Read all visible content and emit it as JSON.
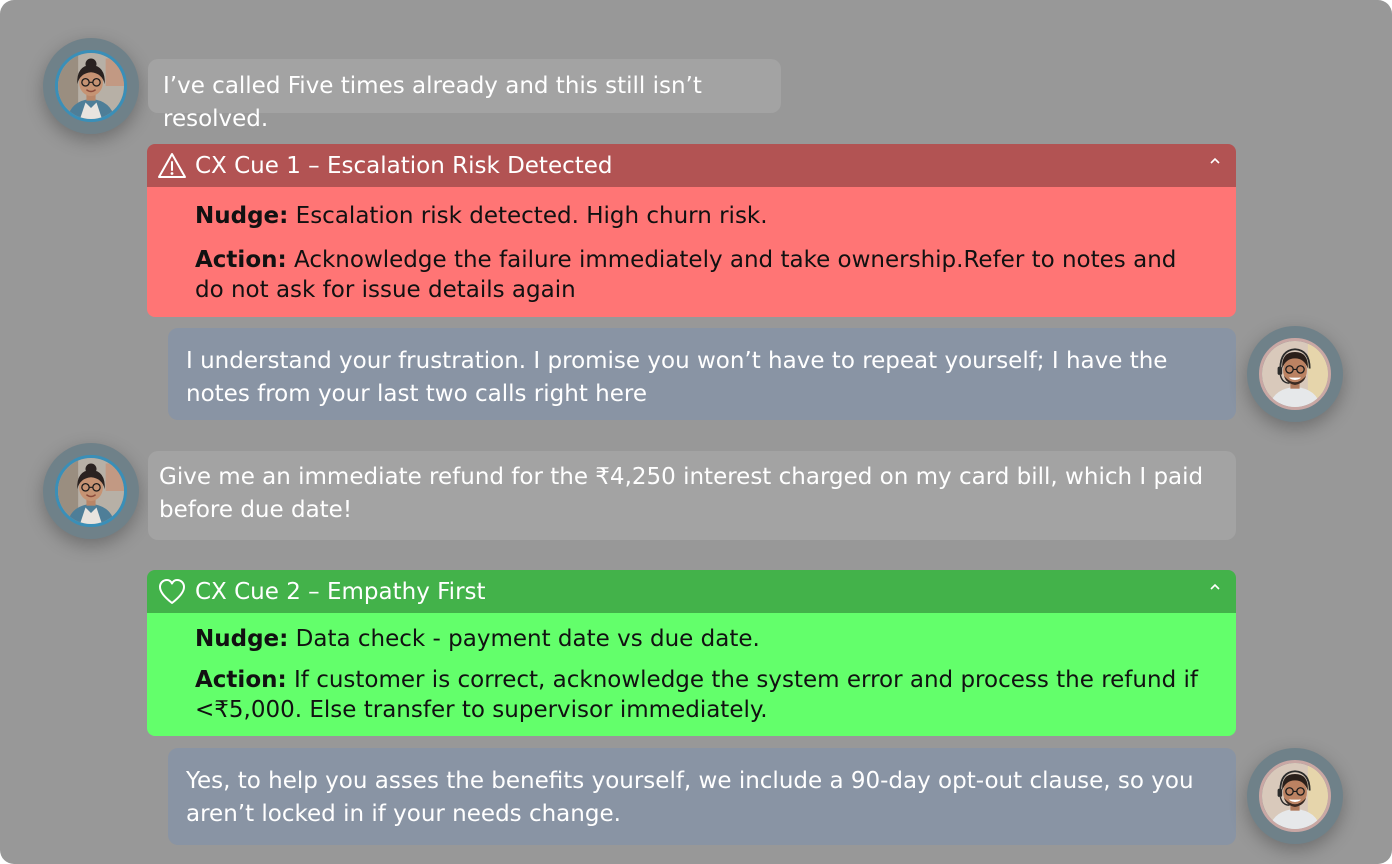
{
  "colors": {
    "background": "#989898",
    "customer_bubble": "#a3a3a3",
    "agent_bubble": "#8994a4",
    "escalation_header": "#b25353",
    "escalation_body": "#ff7575",
    "empathy_header": "#43b24a",
    "empathy_body": "#63ff6b"
  },
  "messages": [
    {
      "speaker": "customer",
      "text": "I’ve called Five times already and this still isn’t resolved."
    },
    {
      "speaker": "agent",
      "text": "I understand your frustration. I promise you won’t have to repeat yourself; I have the notes from your last two calls right here"
    },
    {
      "speaker": "customer",
      "text": "Give me an immediate refund for the ₹4,250 interest charged on my card bill, which I paid before due date!"
    },
    {
      "speaker": "agent",
      "text": "Yes, to help you asses the benefits yourself, we include a 90-day opt-out clause, so you aren’t locked in if your needs change."
    }
  ],
  "cues": [
    {
      "icon": "warning-triangle-icon",
      "title": "CX Cue 1 – Escalation Risk Detected",
      "nudge_label": "Nudge:",
      "nudge_text": " Escalation risk detected. High churn risk.",
      "action_label": "Action:",
      "action_text": " Acknowledge the failure immediately and take ownership.Refer to notes and do not ask for issue details again"
    },
    {
      "icon": "heart-icon",
      "title": "CX Cue 2 – Empathy First",
      "nudge_label": "Nudge:",
      "nudge_text": " Data check - payment date vs due date.",
      "action_label": "Action:",
      "action_text": " If customer is correct, acknowledge the system error and process the refund if <₹5,000. Else transfer to supervisor immediately."
    }
  ]
}
